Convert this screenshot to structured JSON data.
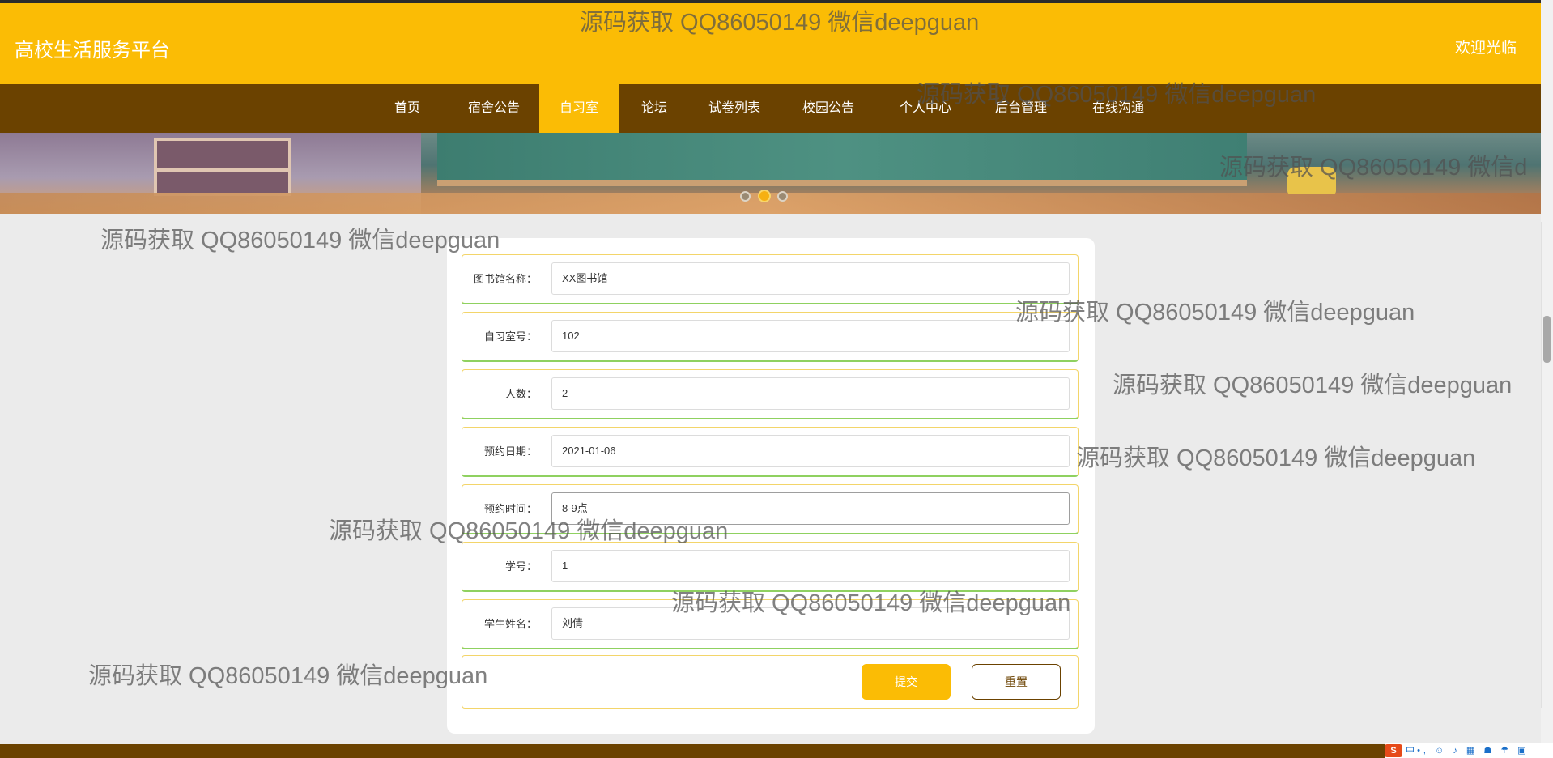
{
  "header": {
    "site_title": "高校生活服务平台",
    "welcome": "欢迎光临"
  },
  "nav": {
    "items": [
      {
        "label": "首页"
      },
      {
        "label": "宿舍公告"
      },
      {
        "label": "自习室",
        "active": true
      },
      {
        "label": "论坛"
      },
      {
        "label": "试卷列表"
      },
      {
        "label": "校园公告"
      },
      {
        "label": "个人中心"
      },
      {
        "label": "后台管理"
      },
      {
        "label": "在线沟通"
      }
    ]
  },
  "carousel": {
    "slide_count": 3,
    "active_index": 1
  },
  "form": {
    "fields": [
      {
        "label": "图书馆名称：",
        "value": "XX图书馆"
      },
      {
        "label": "自习室号：",
        "value": "102"
      },
      {
        "label": "人数：",
        "value": "2"
      },
      {
        "label": "预约日期：",
        "value": "2021-01-06"
      },
      {
        "label": "预约时间：",
        "value": "8-9点"
      },
      {
        "label": "学号：",
        "value": "1"
      },
      {
        "label": "学生姓名：",
        "value": "刘倩"
      }
    ],
    "submit_label": "提交",
    "reset_label": "重置"
  },
  "taskbar": {
    "ime_logo": "S",
    "ime_mode": "中",
    "tray_icons": "•, ☺ ♪ ▦ ☗ ☂ ▣"
  },
  "watermarks": [
    "源码获取 QQ86050149 微信deepguan",
    "源码获取 QQ86050149 微信deepguan",
    "源码获取 QQ86050149 微信d",
    "源码获取 QQ86050149 微信deepguan",
    "源码获取 QQ86050149 微信deepguan",
    "源码获取 QQ86050149 微信deepguan",
    "源码获取 QQ86050149 微信deepguan",
    "源码获取 QQ86050149 微信deepguan",
    "源码获取 QQ86050149 微信deepguan",
    "源码获取 QQ86050149 微信deepguan"
  ],
  "colors": {
    "brand_yellow": "#fbbc05",
    "nav_brown": "#6b4200",
    "background": "#ebebeb"
  }
}
